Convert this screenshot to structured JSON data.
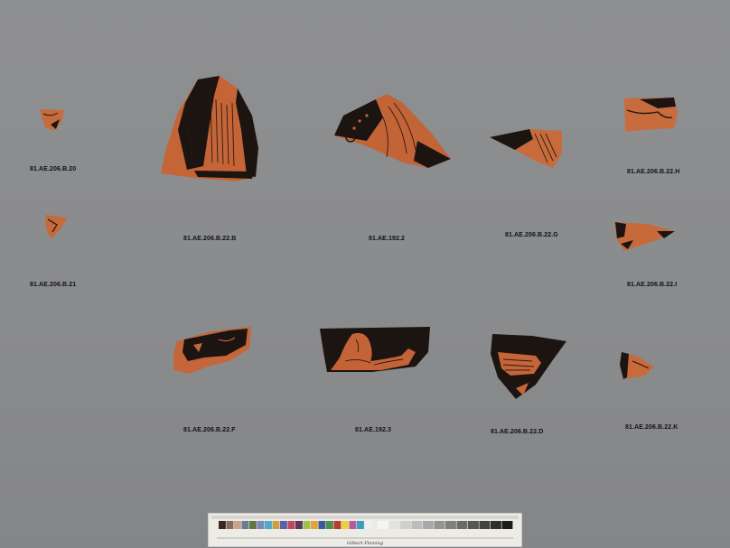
{
  "labels": {
    "b20": "81.AE.206.B.20",
    "b21": "81.AE.206.B.21",
    "b22b": "81.AE.206.B.22.B",
    "ae192_2": "81.AE.192.2",
    "b22g": "81.AE.206.B.22.G",
    "b22h": "81.AE.206.B.22.H",
    "b22i": "81.AE.206.B.22.I",
    "b22f": "81.AE.206.B.22.F",
    "ae192_3": "81.AE.192.3",
    "b22d": "81.AE.206.B.22.D",
    "b22k": "81.AE.206.B.22.K"
  },
  "color_chart": {
    "swatches": [
      "#3a2a22",
      "#8a6a58",
      "#c9a38a",
      "#6b7d91",
      "#5f7a3c",
      "#7b88b8",
      "#4fa9c8",
      "#c7a043",
      "#5d62a8",
      "#c04a5a",
      "#5a3a5c",
      "#9fc24a",
      "#e5a23b",
      "#3d5a9e",
      "#4f8f4a",
      "#b83a32",
      "#e8d23a",
      "#b85a9a",
      "#3aa0b8",
      "#f0f0f0"
    ],
    "grays": [
      "#f4f4f4",
      "#e2e2e2",
      "#cfcfcf",
      "#bcbcbc",
      "#a8a8a8",
      "#939393",
      "#7f7f7f",
      "#6b6b6b",
      "#575757",
      "#434343",
      "#2f2f2f",
      "#1c1c1c"
    ],
    "brand_text": "Gilbert Fleming"
  }
}
